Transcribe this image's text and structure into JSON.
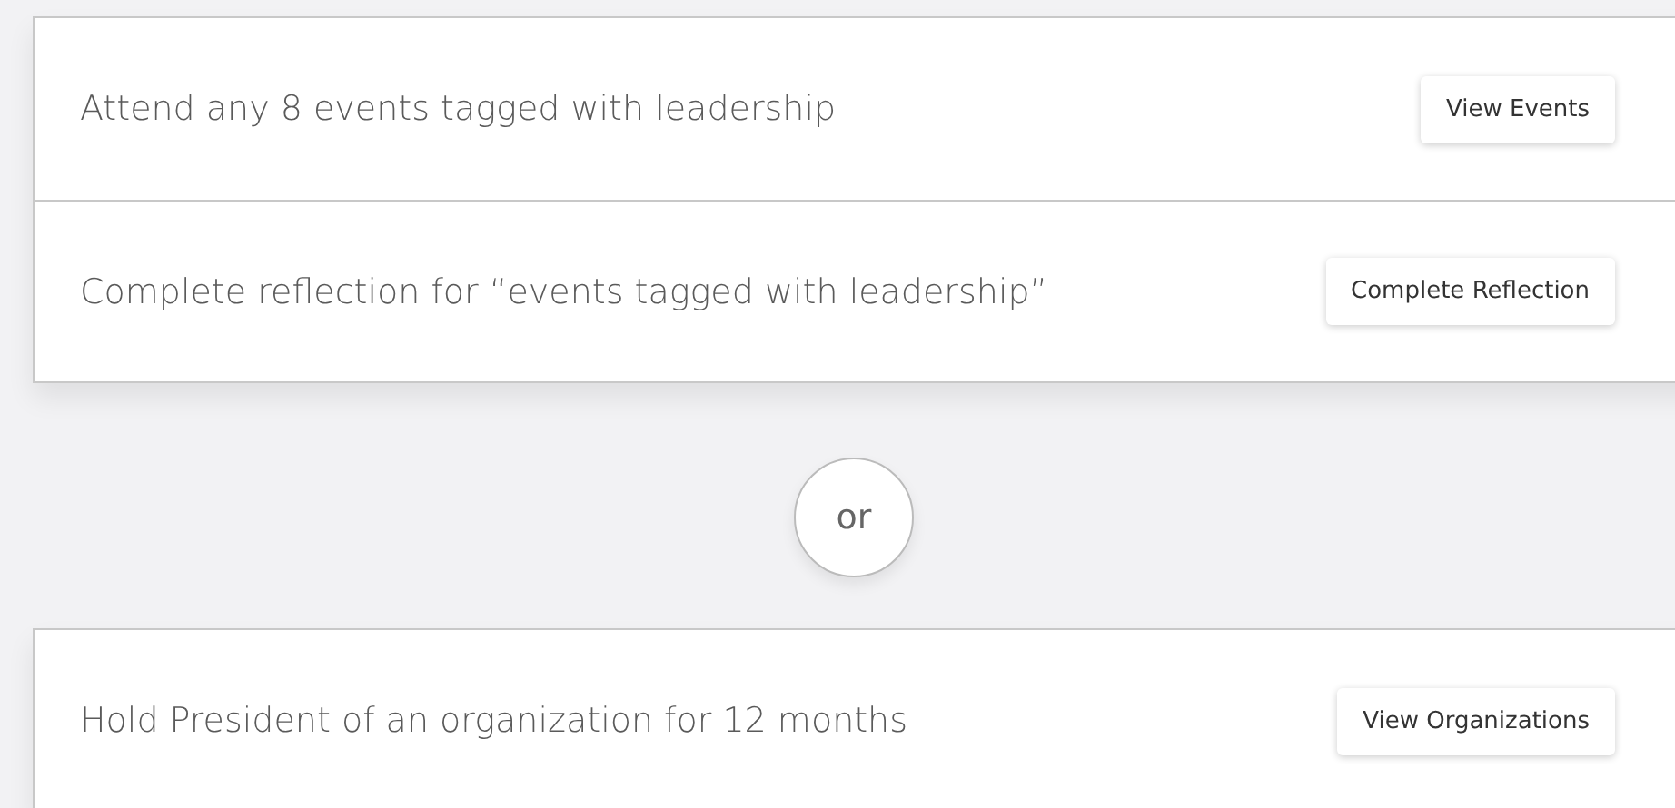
{
  "groups": [
    {
      "rows": [
        {
          "text": "Attend any 8 events tagged with leadership",
          "button": "View Events"
        },
        {
          "text": "Complete reflection for “events tagged with leadership”",
          "button": "Complete Reflection"
        }
      ]
    },
    {
      "rows": [
        {
          "text": "Hold President of an organization for 12 months",
          "button": "View Organizations"
        }
      ]
    }
  ],
  "separator": "or"
}
